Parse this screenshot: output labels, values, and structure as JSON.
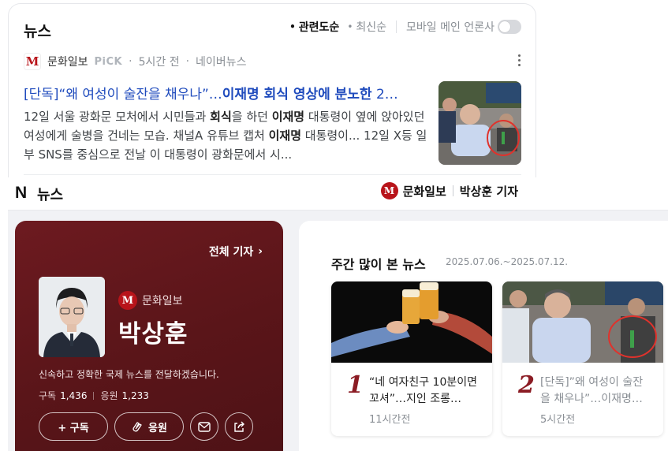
{
  "search_card": {
    "title": "뉴스",
    "sort": {
      "relevance": "관련도순",
      "latest": "최신순",
      "mobile_main_press": "모바일 메인 언론사"
    },
    "article": {
      "press": "문화일보",
      "pick_badge": "PiCK",
      "time": "5시간 전",
      "source": "네이버뉴스",
      "title_prefix": "[단독]“왜 여성이 술잔을 채우나”…",
      "title_highlight": "이재명 회식 영상에 분노한",
      "title_suffix": " 2…",
      "desc_1": "12일 서울 광화문 모처에서 시민들과 ",
      "desc_kw1": "회식",
      "desc_2": "을 하던 ",
      "desc_kw2": "이재명",
      "desc_3": " 대통령이 옆에 앉아있던 여성에게 술병을 건네는 모습. 채널A 유튜브 캡처 ",
      "desc_kw3": "이재명",
      "desc_4": " 대통령이... 12일 X등 일부 SNS를 중심으로 전날 이 대통령이 광화문에서 시..."
    }
  },
  "header": {
    "logo": "N",
    "title": "뉴스",
    "press": "문화일보",
    "reporter_label": "박상훈 기자"
  },
  "reporter": {
    "all_reporters": "전체 기자",
    "press": "문화일보",
    "name": "박상훈",
    "intro": "신속하고 정확한 국제 뉴스를 전달하겠습니다.",
    "subscribe_label": "구독",
    "subscribe_count": "1,436",
    "cheer_label": "응원",
    "cheer_count": "1,233",
    "btn_subscribe": "+ 구독",
    "btn_cheer": "응원"
  },
  "weekly": {
    "title": "주간 많이 본 뉴스",
    "range": "2025.07.06.~2025.07.12.",
    "items": [
      {
        "rank": "1",
        "text": "“네 여자친구 10분이면 꼬셔”…지인 조롱…",
        "time": "11시간전"
      },
      {
        "rank": "2",
        "text": "[단독]”왜 여성이 술잔을 채우나”…이재명…",
        "time": "5시간전"
      }
    ]
  },
  "colors": {
    "accent_red": "#b8141a",
    "reporter_bg": "#5e161b",
    "link_blue": "#1f4bbd"
  }
}
